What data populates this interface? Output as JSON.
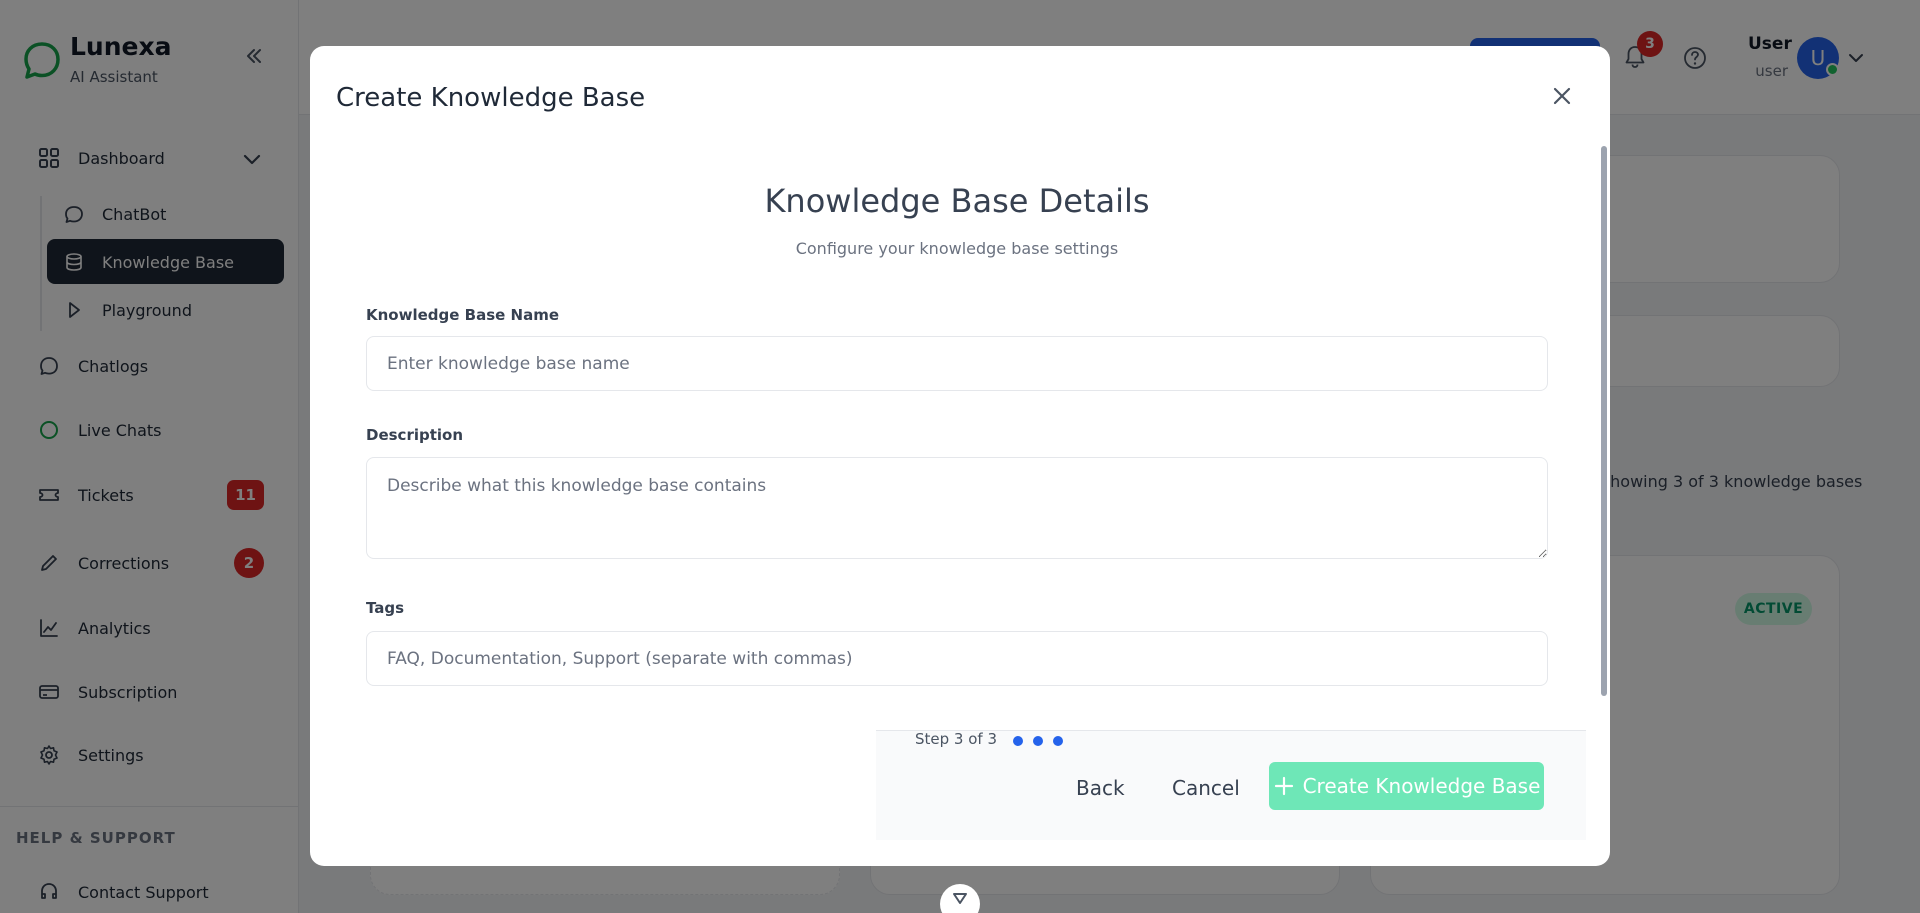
{
  "brand": {
    "name": "Lunexa",
    "subtitle": "AI Assistant"
  },
  "sidebar": {
    "items": [
      {
        "label": "Dashboard",
        "icon": "grid-icon"
      },
      {
        "label": "Chatlogs",
        "icon": "chat-icon"
      },
      {
        "label": "Live Chats",
        "icon": "circle-icon"
      },
      {
        "label": "Tickets",
        "icon": "ticket-icon",
        "badge": "11"
      },
      {
        "label": "Corrections",
        "icon": "pencil-icon",
        "badge": "2"
      },
      {
        "label": "Analytics",
        "icon": "chart-icon"
      },
      {
        "label": "Subscription",
        "icon": "card-icon"
      },
      {
        "label": "Settings",
        "icon": "gear-icon"
      }
    ],
    "subitems": [
      {
        "label": "ChatBot",
        "icon": "chat-icon"
      },
      {
        "label": "Knowledge Base",
        "icon": "database-icon",
        "active": true
      },
      {
        "label": "Playground",
        "icon": "play-icon"
      }
    ],
    "help_heading": "HELP & SUPPORT",
    "contact_support": "Contact Support"
  },
  "header": {
    "notifications_count": "3",
    "user_name": "User",
    "user_role": "user",
    "avatar_initial": "U"
  },
  "background": {
    "showing_text": "Showing 3 of 3 knowledge bases",
    "status_badge": "ACTIVE"
  },
  "modal": {
    "title": "Create Knowledge Base",
    "section_title": "Knowledge Base Details",
    "section_subtitle": "Configure your knowledge base settings",
    "fields": {
      "name": {
        "label": "Knowledge Base Name",
        "placeholder": "Enter knowledge base name",
        "value": ""
      },
      "description": {
        "label": "Description",
        "placeholder": "Describe what this knowledge base contains",
        "value": ""
      },
      "tags": {
        "label": "Tags",
        "placeholder": "FAQ, Documentation, Support (separate with commas)",
        "value": ""
      }
    },
    "footer": {
      "step_text": "Step 3 of 3",
      "back_label": "Back",
      "cancel_label": "Cancel",
      "create_label": "Create Knowledge Base"
    }
  },
  "colors": {
    "accent": "#2563eb",
    "create_button": "#6ee7b7",
    "badge_red": "#dc2626",
    "active_green": "#059669"
  }
}
